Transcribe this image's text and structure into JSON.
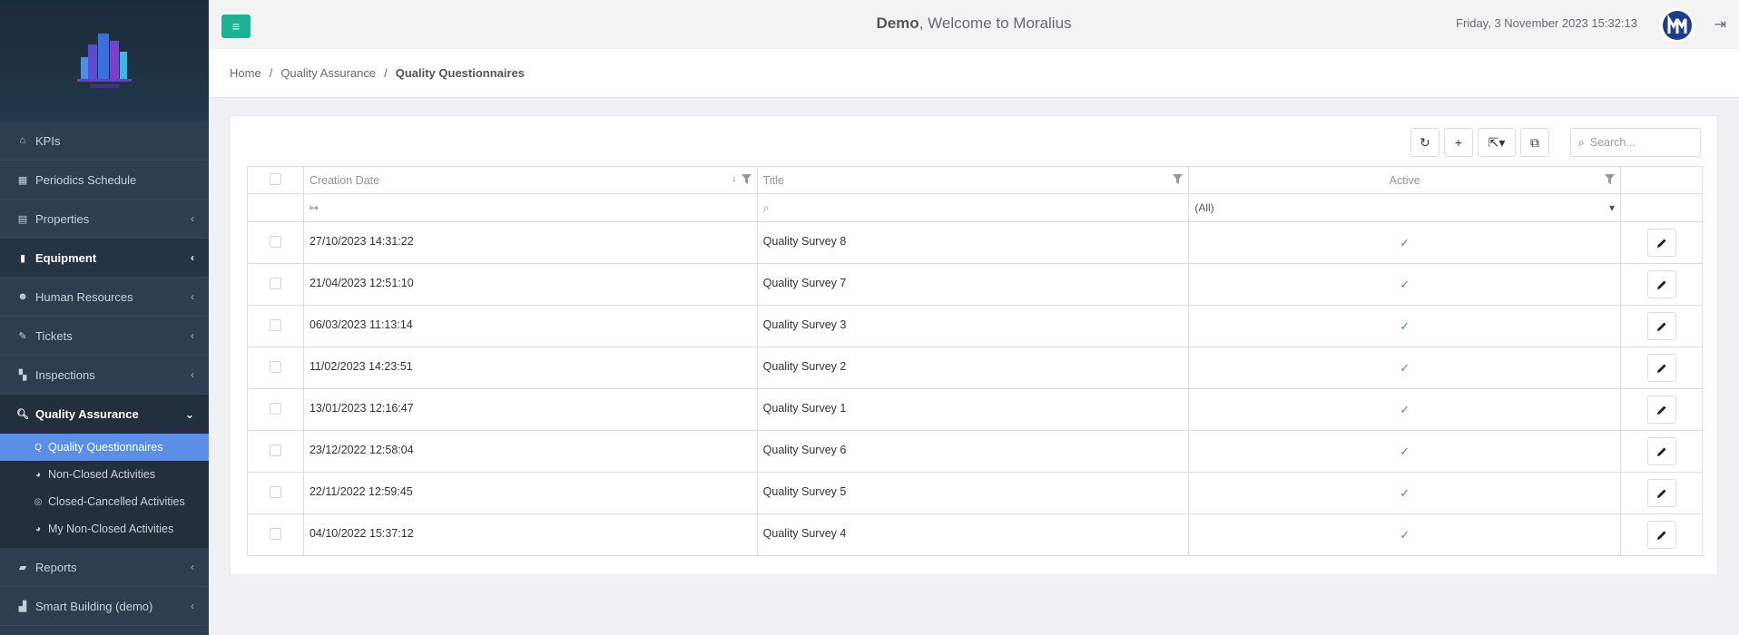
{
  "header": {
    "user": "Demo",
    "welcome_text": ", Welcome to Moralius",
    "datetime": "Friday, 3 November 2023 15:32:13"
  },
  "sidebar": {
    "items": [
      {
        "label": "KPIs",
        "icon": "home-icon"
      },
      {
        "label": "Periodics Schedule",
        "icon": "calendar-icon"
      },
      {
        "label": "Properties",
        "icon": "building-icon"
      },
      {
        "label": "Equipment",
        "icon": "equipment-icon"
      },
      {
        "label": "Human Resources",
        "icon": "users-icon"
      },
      {
        "label": "Tickets",
        "icon": "wrench-icon"
      },
      {
        "label": "Inspections",
        "icon": "map-icon"
      },
      {
        "label": "Quality Assurance",
        "icon": "search-icon"
      },
      {
        "label": "Reports",
        "icon": "book-icon"
      },
      {
        "label": "Smart Building (demo)",
        "icon": "chart-icon"
      }
    ],
    "sub_items": [
      {
        "label": "Quality Questionnaires"
      },
      {
        "label": "Non-Closed Activities"
      },
      {
        "label": "Closed-Cancelled Activities"
      },
      {
        "label": "My Non-Closed Activities"
      }
    ]
  },
  "breadcrumb": {
    "home": "Home",
    "section": "Quality Assurance",
    "current": "Quality Questionnaires"
  },
  "toolbar": {
    "search_placeholder": "Search..."
  },
  "grid": {
    "columns": [
      "Creation Date",
      "Title",
      "Active"
    ],
    "active_filter": "(All)",
    "rows": [
      {
        "date": "27/10/2023 14:31:22",
        "title": "Quality Survey 8",
        "active": true
      },
      {
        "date": "21/04/2023 12:51:10",
        "title": "Quality Survey 7",
        "active": true
      },
      {
        "date": "06/03/2023 11:13:14",
        "title": "Quality Survey 3",
        "active": true
      },
      {
        "date": "11/02/2023 14:23:51",
        "title": "Quality Survey 2",
        "active": true
      },
      {
        "date": "13/01/2023 12:16:47",
        "title": "Quality Survey 1",
        "active": true
      },
      {
        "date": "23/12/2022 12:58:04",
        "title": "Quality Survey 6",
        "active": true
      },
      {
        "date": "22/11/2022 12:59:45",
        "title": "Quality Survey 5",
        "active": true
      },
      {
        "date": "04/10/2022 15:37:12",
        "title": "Quality Survey 4",
        "active": true
      }
    ]
  },
  "colors": {
    "sidebar_bg": "#2c3e50",
    "accent_green": "#1ab394",
    "active_sub": "#5b8ee6",
    "check_blue": "#4a7fd4"
  }
}
